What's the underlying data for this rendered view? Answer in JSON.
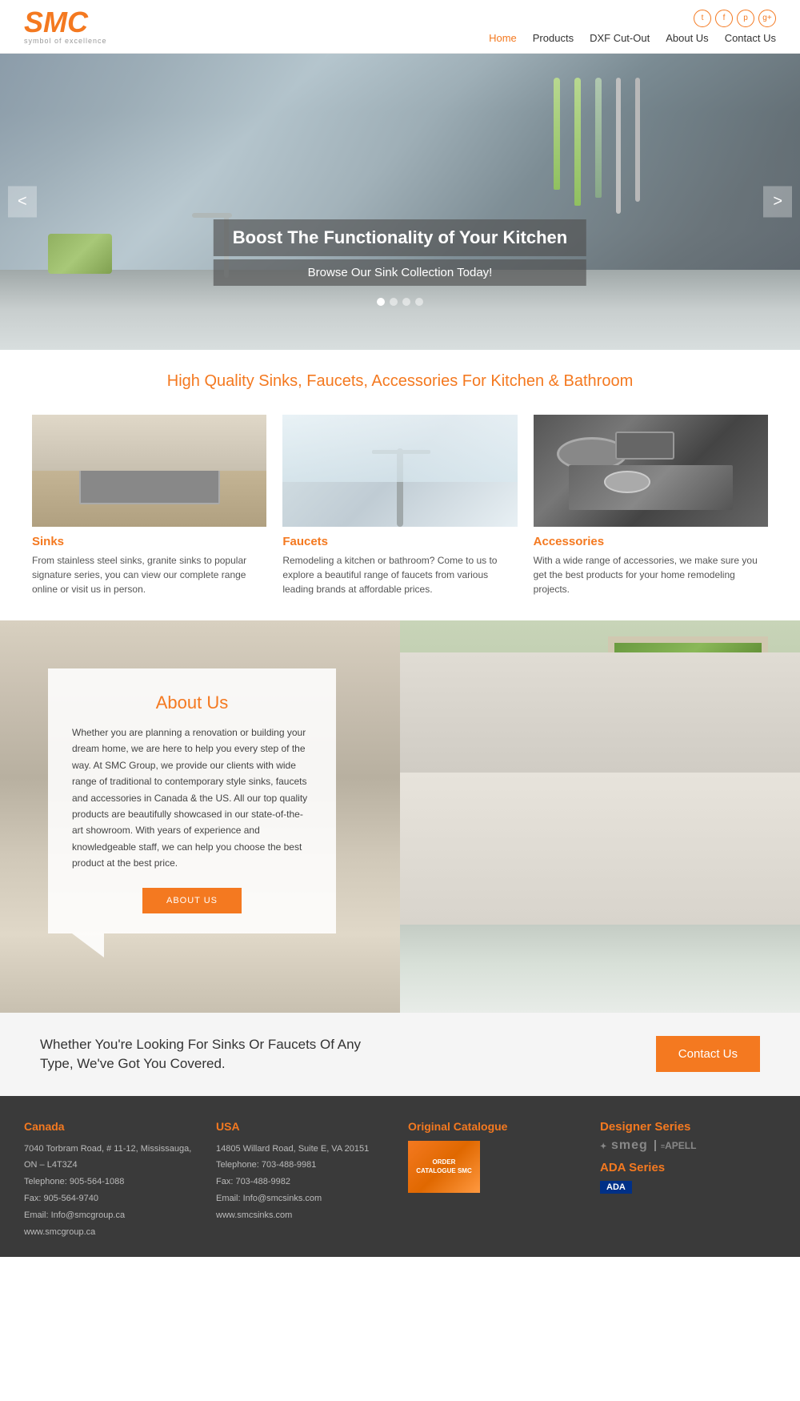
{
  "header": {
    "logo": "SMC",
    "tagline": "symbol of excellence",
    "nav": {
      "items": [
        {
          "label": "Home",
          "active": true
        },
        {
          "label": "Products",
          "active": false
        },
        {
          "label": "DXF Cut-Out",
          "active": false
        },
        {
          "label": "About Us",
          "active": false
        },
        {
          "label": "Contact Us",
          "active": false
        }
      ]
    },
    "social": [
      "t",
      "f",
      "p",
      "g+"
    ]
  },
  "hero": {
    "title": "Boost The Functionality of Your Kitchen",
    "subtitle": "Browse Our Sink Collection Today!",
    "prev_btn": "<",
    "next_btn": ">"
  },
  "tagline": {
    "heading": "High Quality Sinks, Faucets, Accessories For Kitchen & Bathroom"
  },
  "products": [
    {
      "name": "Sinks",
      "description": "From stainless steel sinks, granite sinks to popular signature series, you can view our complete range online or visit us in person."
    },
    {
      "name": "Faucets",
      "description": "Remodeling a kitchen or bathroom? Come to us to explore a beautiful range of faucets from various leading brands at affordable prices."
    },
    {
      "name": "Accessories",
      "description": "With a wide range of accessories, we make sure you get the best products for your home remodeling projects."
    }
  ],
  "about": {
    "heading": "About Us",
    "body": "Whether you are planning a renovation or building your dream home, we are here to help you every step of the way. At SMC Group, we provide our clients with wide range of traditional to contemporary style sinks, faucets and accessories in Canada & the US. All our top quality products are beautifully showcased in our state-of-the-art showroom. With years of experience and knowledgeable staff, we can help you choose the best product at the best price.",
    "btn_label": "ABOUT US"
  },
  "cta": {
    "text": "Whether You're Looking For Sinks Or Faucets Of Any Type, We've Got You Covered.",
    "btn_label": "Contact Us"
  },
  "footer": {
    "canada": {
      "title": "Canada",
      "address": "7040 Torbram Road, # 11-12, Mississauga, ON – L4T3Z4",
      "phone": "Telephone: 905-564-1088",
      "fax": "Fax: 905-564-9740",
      "email": "Email: Info@smcgroup.ca",
      "website": "www.smcgroup.ca"
    },
    "usa": {
      "title": "USA",
      "address": "14805 Willard Road, Suite E, VA 20151",
      "phone": "Telephone: 703-488-9981",
      "fax": "Fax: 703-488-9982",
      "email": "Email: Info@smcsinks.com",
      "website": "www.smcsinks.com"
    },
    "catalogue": {
      "title": "Original Catalogue",
      "img_text": "ORDER CATALOGUE SMC"
    },
    "brands": {
      "designer_series": "Designer Series",
      "smeg": "smeg",
      "apell": "APELL",
      "ada_series": "ADA Series",
      "ada_badge": "ADA"
    }
  }
}
